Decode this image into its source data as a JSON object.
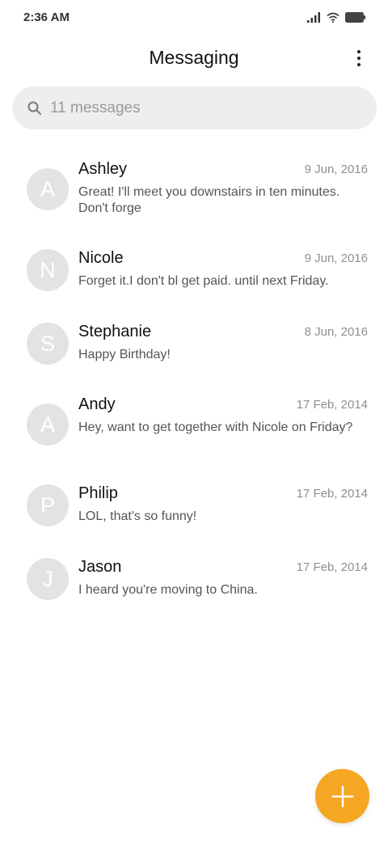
{
  "status_bar": {
    "time": "2:36 AM"
  },
  "header": {
    "title": "Messaging"
  },
  "search": {
    "placeholder": "11 messages"
  },
  "conversations": [
    {
      "initial": "A",
      "name": "Ashley",
      "date": "9 Jun, 2016",
      "preview": "Great! I'll meet you downstairs in ten minutes. Don't forge"
    },
    {
      "initial": "N",
      "name": "Nicole",
      "date": "9 Jun, 2016",
      "preview": "Forget it.I don't bl get paid. until next Friday."
    },
    {
      "initial": "S",
      "name": "Stephanie",
      "date": "8 Jun, 2016",
      "preview": "Happy Birthday!"
    },
    {
      "initial": "A",
      "name": "Andy",
      "date": "17 Feb, 2014",
      "preview": "Hey, want to get together with Nicole on Friday?"
    },
    {
      "initial": "P",
      "name": "Philip",
      "date": "17 Feb, 2014",
      "preview": "LOL, that's so funny!"
    },
    {
      "initial": "J",
      "name": "Jason",
      "date": "17 Feb, 2014",
      "preview": "I heard you're moving to China."
    }
  ],
  "colors": {
    "accent": "#f5a623",
    "avatar_bg": "#e3e3e6",
    "search_bg": "#eeeeee"
  },
  "icons": {
    "fab": "plus-icon",
    "search": "search-icon",
    "menu": "more-vertical-icon"
  }
}
